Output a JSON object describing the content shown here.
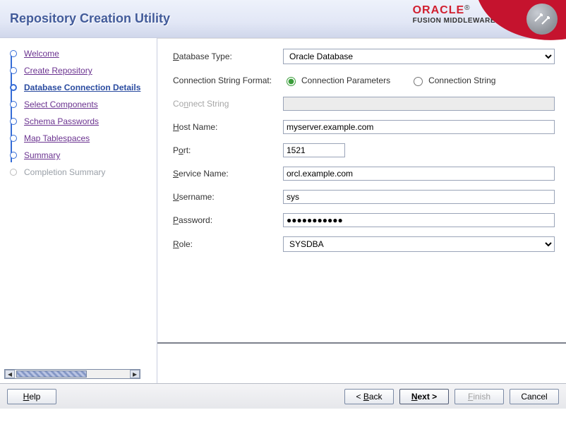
{
  "header": {
    "title": "Repository Creation Utility",
    "brand_top": "ORACLE",
    "brand_reg": "®",
    "brand_sub": "FUSION MIDDLEWARE"
  },
  "steps": [
    {
      "label": "Welcome",
      "state": "past"
    },
    {
      "label": "Create Repository",
      "state": "past"
    },
    {
      "label": "Database Connection Details",
      "state": "current"
    },
    {
      "label": "Select Components",
      "state": "next"
    },
    {
      "label": "Schema Passwords",
      "state": "next"
    },
    {
      "label": "Map Tablespaces",
      "state": "next"
    },
    {
      "label": "Summary",
      "state": "next"
    },
    {
      "label": "Completion Summary",
      "state": "future"
    }
  ],
  "form": {
    "db_type_label": "Database Type:",
    "db_type_value": "Oracle Database",
    "csf_label": "Connection String Format:",
    "csf_options": {
      "params": "Connection Parameters",
      "string": "Connection String"
    },
    "csf_selected": "params",
    "connect_string_label": "Connect String",
    "connect_string_value": "",
    "host_label": "Host Name:",
    "host_value": "myserver.example.com",
    "port_label": "Port:",
    "port_value": "1521",
    "service_label": "Service Name:",
    "service_value": "orcl.example.com",
    "user_label": "Username:",
    "user_value": "sys",
    "pass_label": "Password:",
    "pass_value": "●●●●●●●●●●●",
    "role_label": "Role:",
    "role_value": "SYSDBA"
  },
  "footer": {
    "help": "Help",
    "back": "< Back",
    "next": "Next >",
    "finish": "Finish",
    "cancel": "Cancel"
  }
}
